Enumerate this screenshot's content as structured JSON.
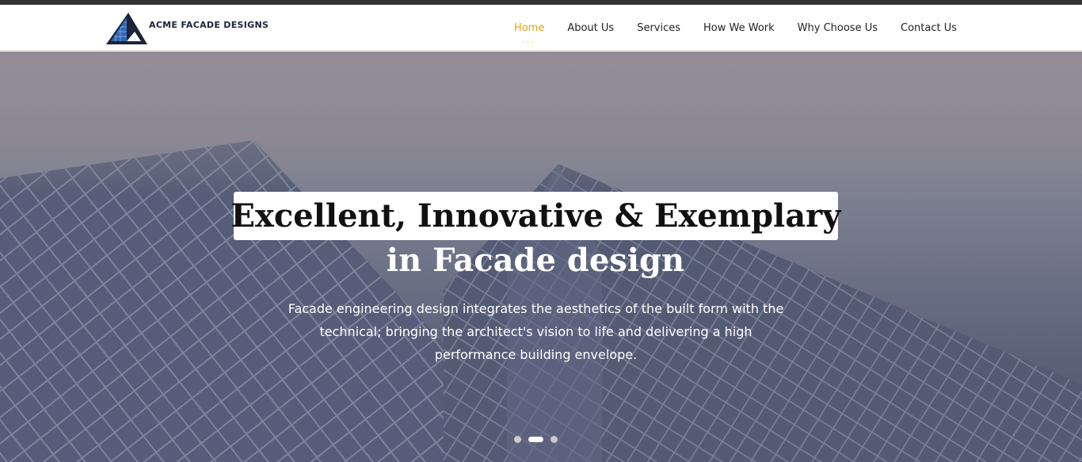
{
  "brand": {
    "name": "ACME FACADE DESIGNS",
    "logo_icon": "triangle-facade-logo-icon",
    "colors": {
      "dark": "#1d2338",
      "blue": "#2f67b4"
    }
  },
  "nav": {
    "items": [
      {
        "label": "Home",
        "active": true
      },
      {
        "label": "About Us",
        "active": false
      },
      {
        "label": "Services",
        "active": false
      },
      {
        "label": "How We Work",
        "active": false
      },
      {
        "label": "Why Choose Us",
        "active": false
      },
      {
        "label": "Contact Us",
        "active": false
      }
    ],
    "active_color": "#e0a11b",
    "active_indicator": "..."
  },
  "hero": {
    "title": "Excellent, Innovative & Exemplary",
    "subtitle": "in Facade design",
    "description": "Facade engineering design integrates the aesthetics of the built form with the technical; bringing the architect's vision to life and delivering a high performance building envelope.",
    "slides": {
      "total": 3,
      "active_index": 1
    }
  }
}
